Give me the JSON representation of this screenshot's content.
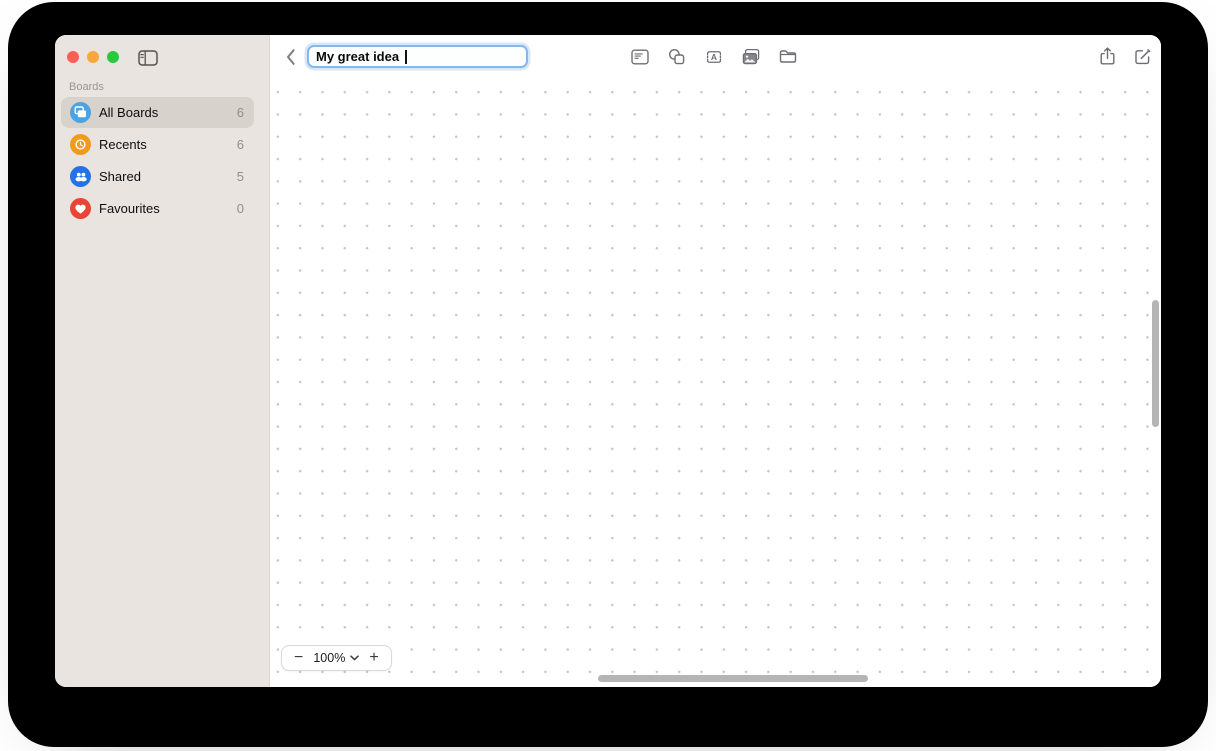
{
  "app": "Freeform",
  "colors": {
    "traffic_red": "#ff5f57",
    "traffic_yellow": "#f7a73c",
    "traffic_green": "#28c840",
    "focus_ring": "#85b8ea",
    "sidebar_bg": "#e9e4df",
    "sidebar_selected_bg": "#d8d2cc"
  },
  "sidebar": {
    "section_label": "Boards",
    "items": [
      {
        "label": "All Boards",
        "count": "6",
        "icon": "all-boards-icon",
        "icon_bg": "#4BA3E3",
        "selected": true
      },
      {
        "label": "Recents",
        "count": "6",
        "icon": "recents-clock-icon",
        "icon_bg": "#F09A1E",
        "selected": false
      },
      {
        "label": "Shared",
        "count": "5",
        "icon": "shared-people-icon",
        "icon_bg": "#2372E8",
        "selected": false
      },
      {
        "label": "Favourites",
        "count": "0",
        "icon": "favourites-heart-icon",
        "icon_bg": "#EA4437",
        "selected": false
      }
    ]
  },
  "toolbar": {
    "back_icon": "chevron-left-icon",
    "title_value": "My great idea",
    "text_tool_letter": "A",
    "tool_icon_names": [
      "sticky-note-icon",
      "shapes-icon",
      "text-box-icon",
      "media-icon",
      "files-icon"
    ],
    "action_icon_names": [
      "share-icon",
      "new-board-compose-icon"
    ]
  },
  "zoom_controls": {
    "minus_label": "−",
    "level": "100%",
    "plus_label": "+"
  }
}
